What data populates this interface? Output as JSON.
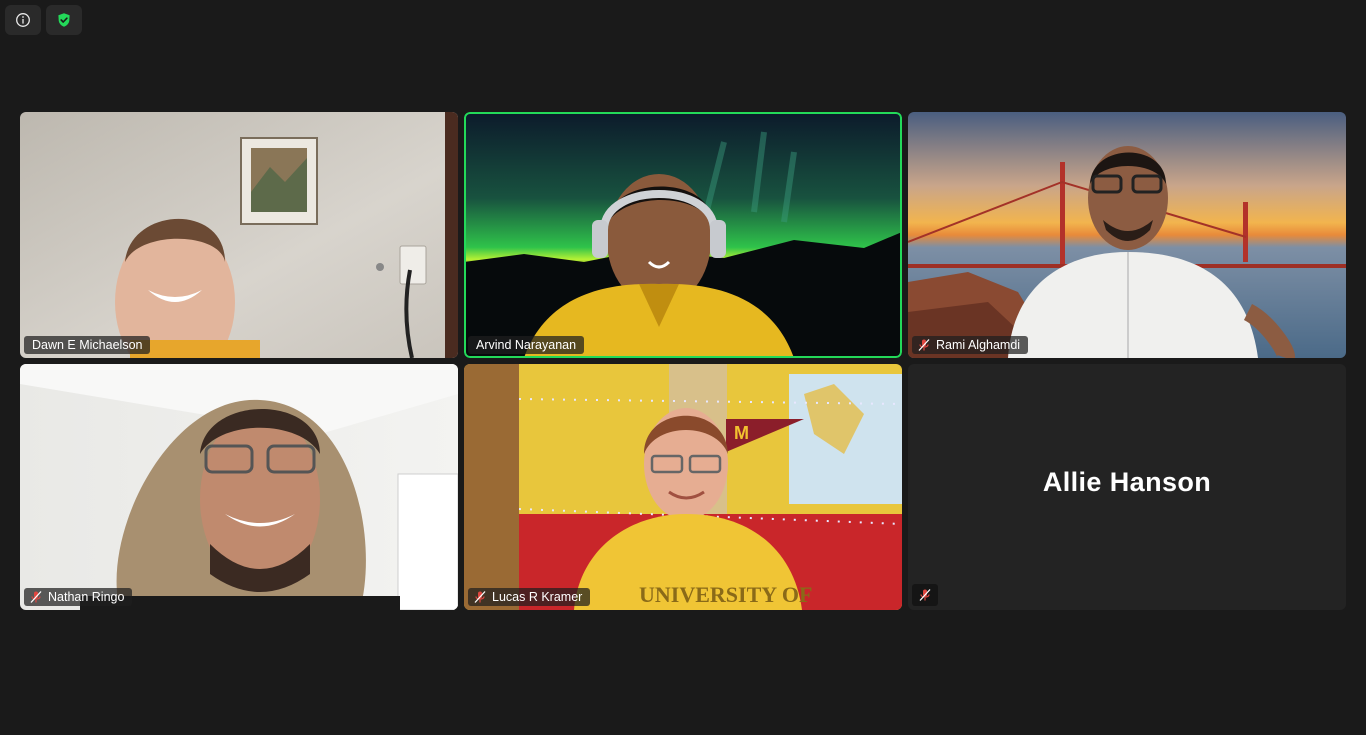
{
  "toolbar": {
    "info_icon": "info-icon",
    "security_icon": "shield-check-icon",
    "security_color": "#23d959"
  },
  "active_speaker_color": "#23d959",
  "participants": [
    {
      "name": "Dawn E Michaelson",
      "muted": false,
      "video": true
    },
    {
      "name": "Arvind Narayanan",
      "muted": false,
      "video": true,
      "active_speaker": true
    },
    {
      "name": "Rami Alghamdi",
      "muted": true,
      "video": true
    },
    {
      "name": "Nathan Ringo",
      "muted": true,
      "video": true
    },
    {
      "name": "Lucas R Kramer",
      "muted": true,
      "video": true
    },
    {
      "name": "Allie Hanson",
      "muted": true,
      "video": false
    }
  ],
  "muted_icon_color": "#e0463f"
}
